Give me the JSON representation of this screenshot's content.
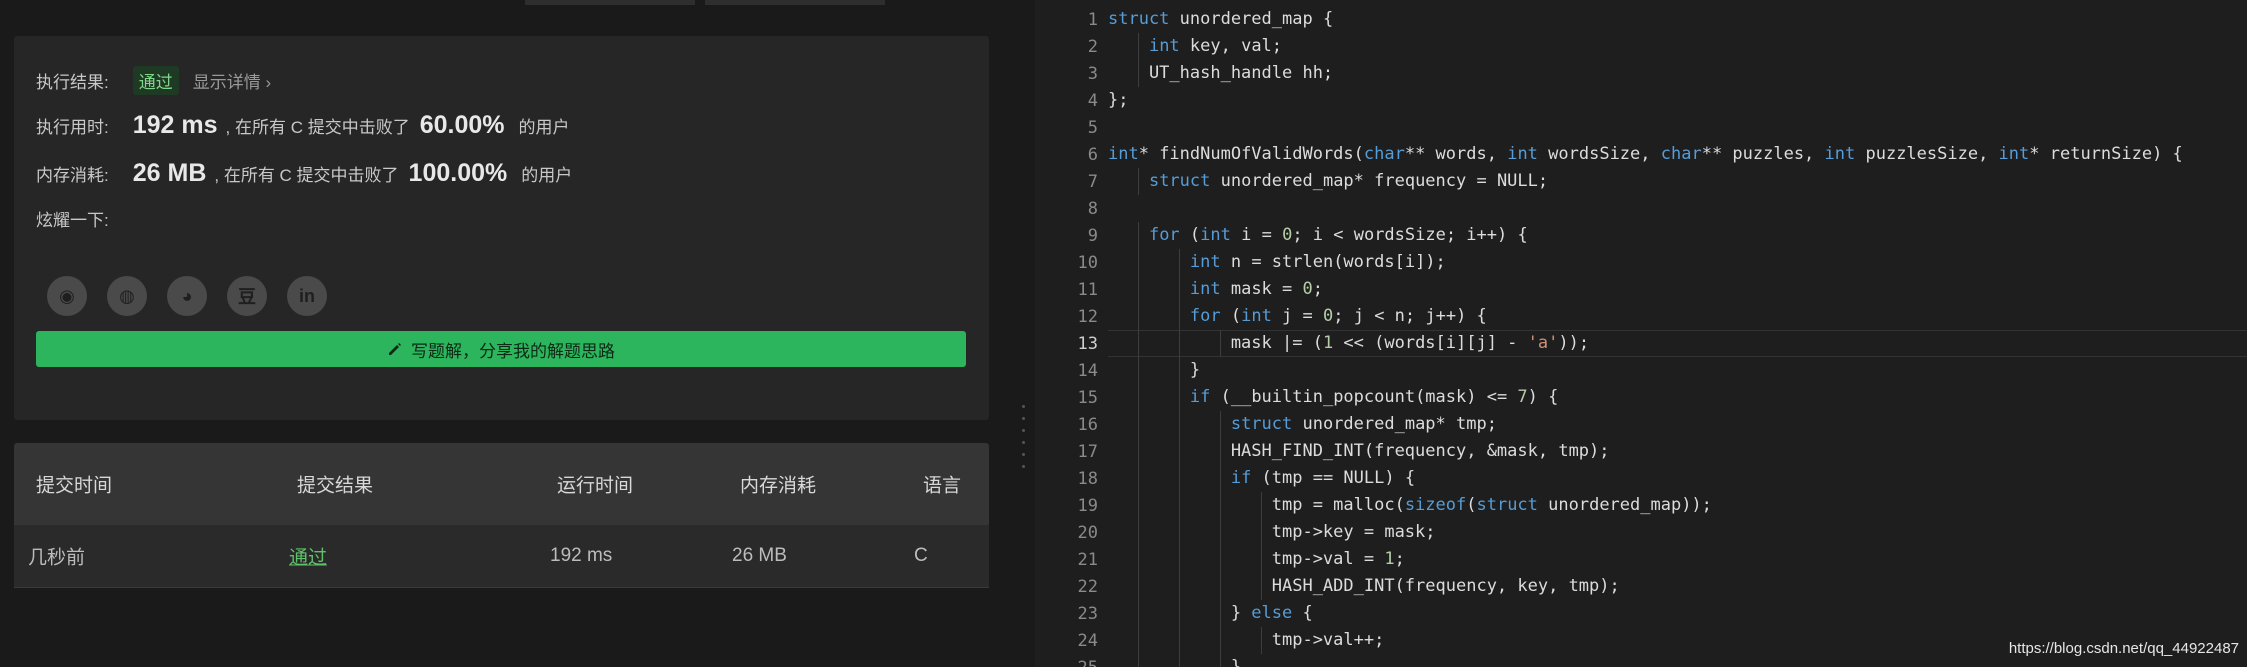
{
  "result": {
    "status_label": "执行结果:",
    "status_value": "通过",
    "detail_link": "显示详情 ›",
    "runtime_label": "执行用时:",
    "runtime_value": "192 ms",
    "runtime_mid": ", 在所有 C 提交中击败了",
    "runtime_percent": "60.00%",
    "runtime_suffix": "的用户",
    "memory_label": "内存消耗:",
    "memory_value": "26 MB",
    "memory_mid": ", 在所有 C 提交中击败了",
    "memory_percent": "100.00%",
    "memory_suffix": "的用户",
    "share_label": "炫耀一下:",
    "social_icons": [
      "wechat-icon",
      "weibo-icon",
      "qq-icon",
      "douban-icon",
      "linkedin-icon"
    ],
    "social_glyphs": [
      "◉",
      "◍",
      "◕",
      "豆",
      "in"
    ],
    "write_button": "写题解，分享我的解题思路"
  },
  "table": {
    "headers": [
      "提交时间",
      "提交结果",
      "运行时间",
      "内存消耗",
      "语言"
    ],
    "row": [
      "几秒前",
      "通过",
      "192 ms",
      "26 MB",
      "C"
    ]
  },
  "editor": {
    "active_line": 13,
    "lines": [
      "struct unordered_map {",
      "    int key, val;",
      "    UT_hash_handle hh;",
      "};",
      "",
      "int* findNumOfValidWords(char** words, int wordsSize, char** puzzles, int puzzlesSize, int* returnSize) {",
      "    struct unordered_map* frequency = NULL;",
      "",
      "    for (int i = 0; i < wordsSize; i++) {",
      "        int n = strlen(words[i]);",
      "        int mask = 0;",
      "        for (int j = 0; j < n; j++) {",
      "            mask |= (1 << (words[i][j] - 'a'));",
      "        }",
      "        if (__builtin_popcount(mask) <= 7) {",
      "            struct unordered_map* tmp;",
      "            HASH_FIND_INT(frequency, &mask, tmp);",
      "            if (tmp == NULL) {",
      "                tmp = malloc(sizeof(struct unordered_map));",
      "                tmp->key = mask;",
      "                tmp->val = 1;",
      "                HASH_ADD_INT(frequency, key, tmp);",
      "            } else {",
      "                tmp->val++;",
      "            }"
    ]
  },
  "watermark": "https://blog.csdn.net/qq_44922487",
  "colors": {
    "keyword": "#569cd6",
    "number": "#b5cea8",
    "string": "#ce9178",
    "accent_green": "#2db55d"
  }
}
